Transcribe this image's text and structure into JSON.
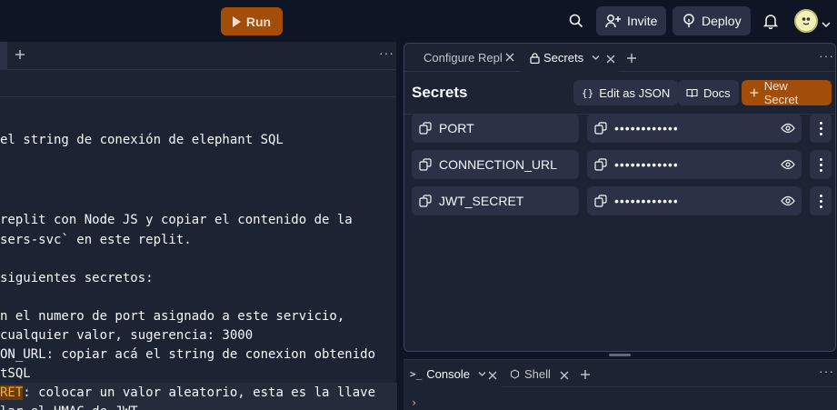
{
  "topbar": {
    "run_label": "Run",
    "invite_label": "Invite",
    "deploy_label": "Deploy",
    "icons": [
      "search-icon",
      "invite-icon",
      "deploy-icon",
      "bell-icon",
      "avatar",
      "chevron-down-icon"
    ]
  },
  "editor": {
    "lines": [
      {
        "text": "el string de conexión de elephant SQL"
      },
      {
        "text": "replit con Node JS y copiar el contenido de la"
      },
      {
        "text": "sers-svc` en este replit."
      },
      {
        "text": "siguientes secretos:"
      },
      {
        "text": "n el numero de port asignado a este servicio,"
      },
      {
        "text": "cualquier valor, sugerencia: 3000"
      },
      {
        "text": "ON_URL: copiar acá el string de conexion obtenido"
      },
      {
        "text": "tSQL"
      },
      {
        "text_hl": "RET",
        "text": ": colocar un valor aleatorio, esta es la llave"
      },
      {
        "text": "lar el HMAC de JWT"
      }
    ]
  },
  "secrets_panel": {
    "tabs": [
      {
        "label": "Configure Repl"
      },
      {
        "label": "Secrets"
      }
    ],
    "title": "Secrets",
    "edit_json_label": "Edit as JSON",
    "docs_label": "Docs",
    "new_secret_label": "New Secret",
    "secrets": [
      {
        "key": "PORT",
        "value": "••••••••••••"
      },
      {
        "key": "CONNECTION_URL",
        "value": "••••••••••••"
      },
      {
        "key": "JWT_SECRET",
        "value": "••••••••••••"
      }
    ]
  },
  "console_panel": {
    "tabs": [
      {
        "label": "Console"
      },
      {
        "label": "Shell"
      }
    ],
    "prompt": "›"
  },
  "colors": {
    "background": "#0e1525",
    "panel": "#1c2333",
    "control": "#2b3245",
    "accent_orange": "#a34d0a",
    "prompt_yellow": "#f0b03a"
  }
}
